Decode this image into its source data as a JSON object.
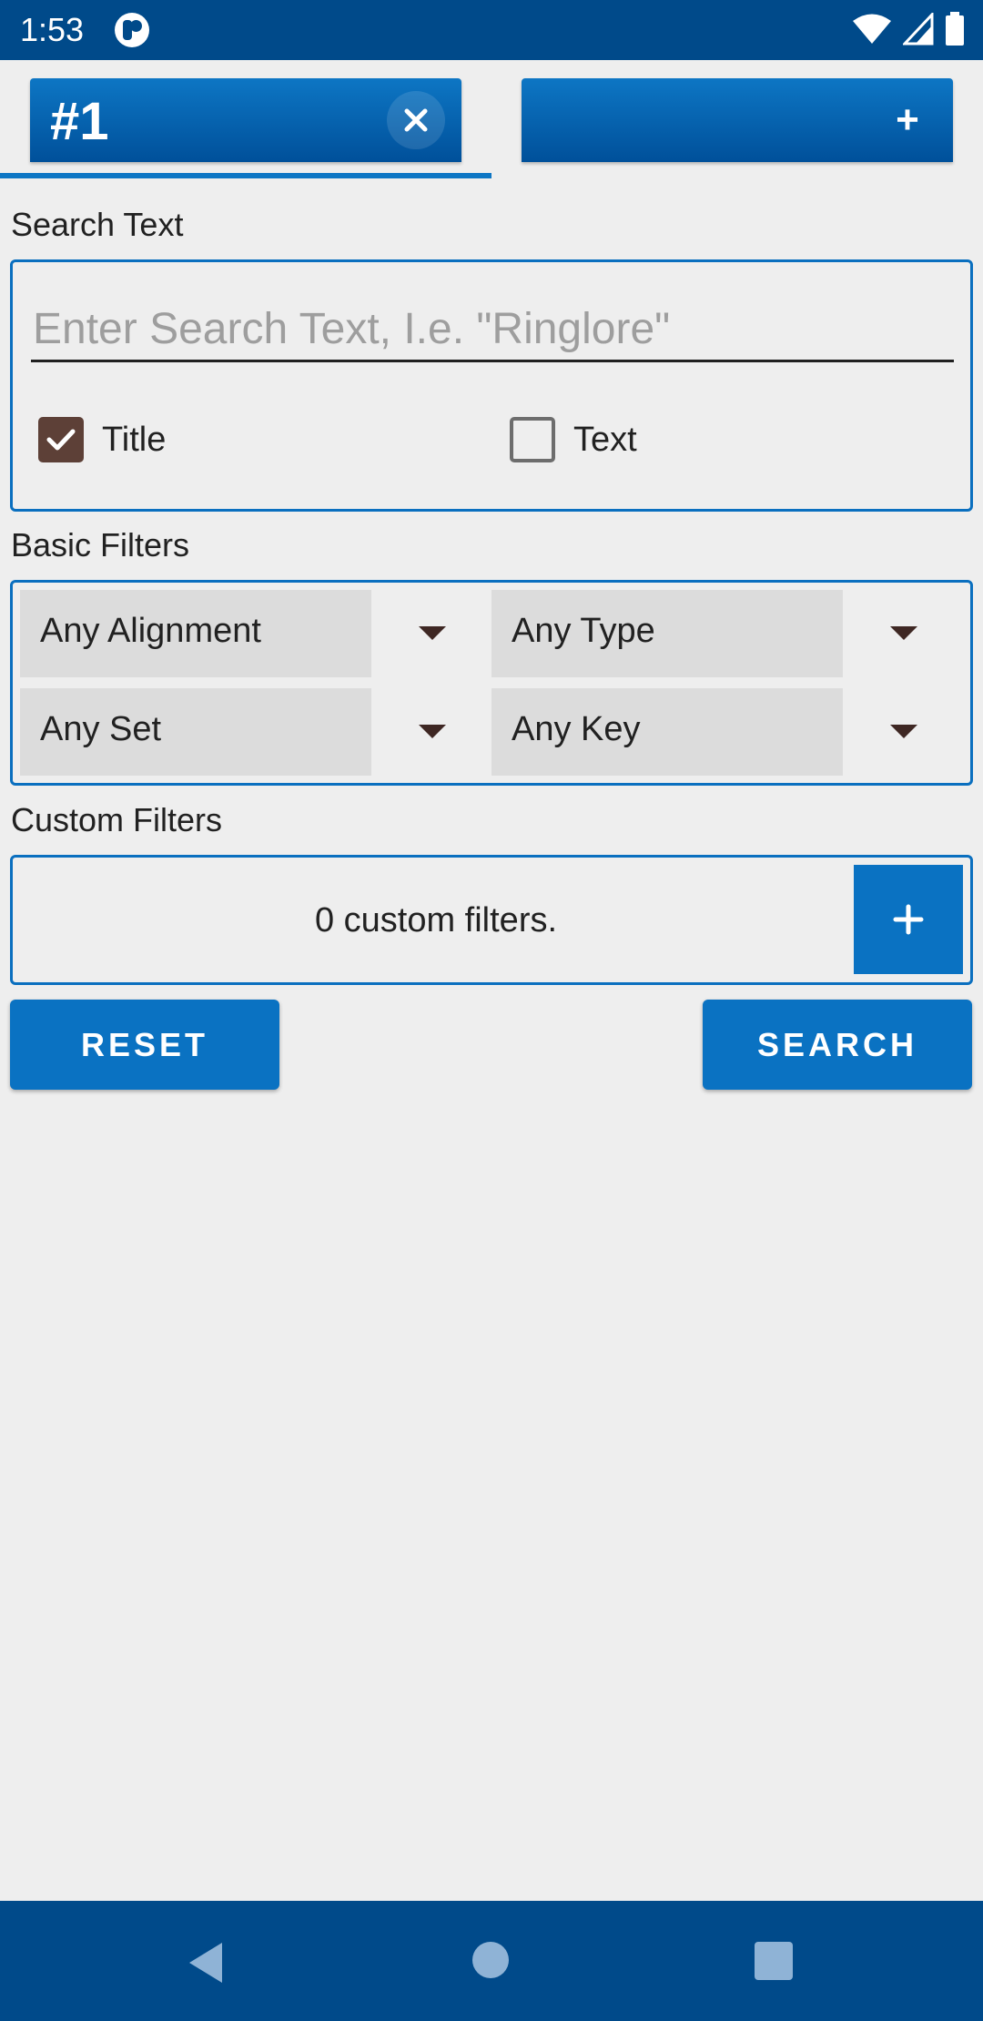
{
  "status_bar": {
    "time": "1:53",
    "icons": [
      "app-notification-icon",
      "wifi-icon",
      "signal-icon",
      "battery-icon"
    ]
  },
  "tabs": [
    {
      "label": "#1",
      "active": true,
      "action_icon": "close-icon"
    },
    {
      "label": "",
      "active": false,
      "action_icon": "plus-icon",
      "action_label": "+"
    }
  ],
  "search_text": {
    "section_label": "Search Text",
    "placeholder": "Enter Search Text, I.e. \"Ringlore\"",
    "value": "",
    "options": [
      {
        "label": "Title",
        "checked": true
      },
      {
        "label": "Text",
        "checked": false
      }
    ]
  },
  "basic_filters": {
    "section_label": "Basic Filters",
    "dropdowns": [
      {
        "selected": "Any Alignment"
      },
      {
        "selected": "Any Type"
      },
      {
        "selected": "Any Set"
      },
      {
        "selected": "Any Key"
      }
    ]
  },
  "custom_filters": {
    "section_label": "Custom Filters",
    "count_text": "0 custom filters.",
    "add_label": "+"
  },
  "actions": {
    "reset_label": "RESET",
    "search_label": "SEARCH"
  },
  "colors": {
    "primary": "#0a72c2",
    "dark_primary": "#004a8a",
    "checkbox_checked": "#5d4037",
    "background": "#eeeeee"
  },
  "nav_bar": {
    "icons": [
      "back-icon",
      "home-icon",
      "recents-icon"
    ]
  }
}
